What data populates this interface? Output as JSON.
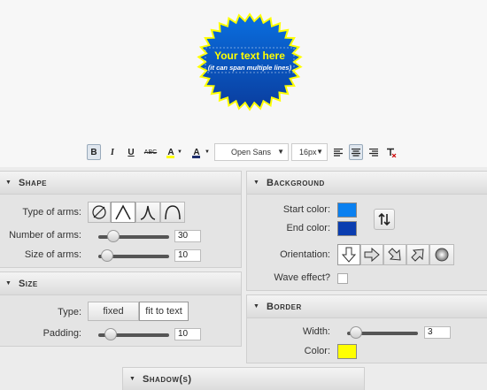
{
  "badge": {
    "title": "Your text here",
    "subtitle": "(it can span multiple lines)",
    "fill_start": "#0a6fe0",
    "fill_end": "#0a3d9e",
    "border_color": "#ffff00"
  },
  "toolbar": {
    "bold": "B",
    "italic": "I",
    "underline": "U",
    "strike": "ABC",
    "font_color_label": "A",
    "highlight_label": "A",
    "font_family": "Open Sans",
    "font_size": "16px",
    "text_color": "#ffff00",
    "highlight_color": "#1f2f6e"
  },
  "shape": {
    "title": "Shape",
    "type_label": "Type of arms:",
    "arm_types": [
      "none-arms",
      "pointed-arms",
      "spike-arms",
      "round-arms"
    ],
    "number_label": "Number of arms:",
    "number_value": "30",
    "number_fraction": 0.15,
    "size_label": "Size of arms:",
    "size_value": "10",
    "size_fraction": 0.05
  },
  "size": {
    "title": "Size",
    "type_label": "Type:",
    "fixed_label": "fixed",
    "fit_label": "fit to text",
    "padding_label": "Padding:",
    "padding_value": "10",
    "padding_fraction": 0.1
  },
  "background": {
    "title": "Background",
    "start_label": "Start color:",
    "start_color": "#0a80f0",
    "end_label": "End color:",
    "end_color": "#0a3db0",
    "orientation_label": "Orientation:",
    "wave_label": "Wave effect?"
  },
  "border": {
    "title": "Border",
    "width_label": "Width:",
    "width_value": "3",
    "width_fraction": 0.05,
    "color_label": "Color:",
    "color": "#ffff00"
  },
  "shadow": {
    "title": "Shadow(s)"
  }
}
